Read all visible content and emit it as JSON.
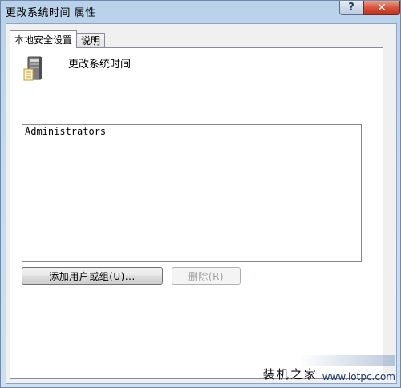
{
  "window": {
    "title": "更改系统时间 属性",
    "help_glyph": "?",
    "close_glyph": "✕"
  },
  "tabs": [
    {
      "label": "本地安全设置",
      "active": true
    },
    {
      "label": "说明",
      "active": false
    }
  ],
  "policy": {
    "title": "更改系统时间",
    "icon": "server-computer-icon"
  },
  "user_list": {
    "items": [
      "Administrators"
    ]
  },
  "buttons": {
    "add_label": "添加用户或组(U)...",
    "remove_label": "删除(R)"
  },
  "watermark": {
    "name": "装机之家",
    "url": "www.lotpc.com"
  }
}
